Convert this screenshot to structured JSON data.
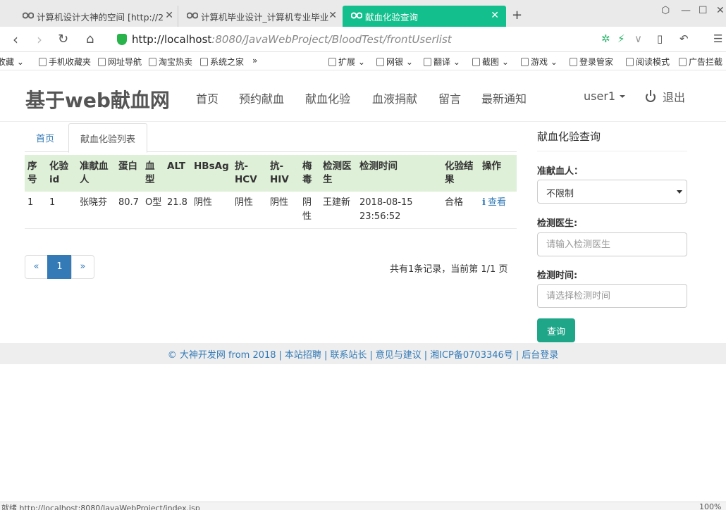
{
  "browser": {
    "tabs": [
      {
        "title": "计算机设计大神的空间 [http://2",
        "active": false
      },
      {
        "title": "计算机毕业设计_计算机专业毕业",
        "active": false
      },
      {
        "title": "献血化验查询",
        "active": true
      }
    ],
    "new_tab": "+",
    "url_host": "http://localhost",
    "url_path": ":8080/JavaWebProject/BloodTest/frontUserlist",
    "bookmarks": [
      "收藏",
      "手机收藏夹",
      "网址导航",
      "淘宝热卖",
      "系统之家",
      "»",
      "扩展",
      "网银",
      "翻译",
      "截图",
      "游戏",
      "登录管家",
      "阅读模式",
      "广告拦截"
    ]
  },
  "site": {
    "brand": "基于web献血网",
    "nav": [
      "首页",
      "预约献血",
      "献血化验",
      "血液捐献",
      "留言",
      "最新通知"
    ],
    "user": "user1",
    "logout": "退出"
  },
  "content": {
    "tabs": {
      "home": "首页",
      "current": "献血化验列表"
    },
    "table": {
      "headers": [
        "序号",
        "化验id",
        "准献血人",
        "蛋白",
        "血型",
        "ALT",
        "HBsAg",
        "抗-HCV",
        "抗-HIV",
        "梅毒",
        "检测医生",
        "检测时间",
        "化验结果",
        "操作"
      ],
      "rows": [
        {
          "no": "1",
          "id": "1",
          "donor": "张晓芬",
          "protein": "80.7",
          "blood_type": "O型",
          "alt": "21.8",
          "hbsag": "阴性",
          "hcv": "阴性",
          "hiv": "阴性",
          "syphilis": "阴性",
          "doctor": "王建新",
          "time": "2018-08-15 23:56:52",
          "result": "合格",
          "action": "查看"
        }
      ]
    },
    "pagination": {
      "prev": "«",
      "page": "1",
      "next": "»",
      "info": "共有1条记录，当前第 1/1 页"
    }
  },
  "sidebar": {
    "title": "献血化验查询",
    "donor_label": "准献血人：",
    "donor_value": "不限制",
    "doctor_label": "检测医生:",
    "doctor_placeholder": "请输入检测医生",
    "time_label": "检测时间:",
    "time_placeholder": "请选择检测时间",
    "query_button": "查询"
  },
  "footer": {
    "links": [
      "© 大神开发网 from 2018",
      "本站招聘",
      "联系站长",
      "意见与建议",
      "湘ICP备0703346号",
      "后台登录"
    ]
  },
  "statusbar": {
    "left": "就绪  http://localhost:8080/JavaWebProject/index.jsp",
    "right": "100%"
  },
  "colors": {
    "active_tab": "#13c08d",
    "table_header": "#dff0d8",
    "link": "#337ab7",
    "query_button": "#1fa689"
  }
}
